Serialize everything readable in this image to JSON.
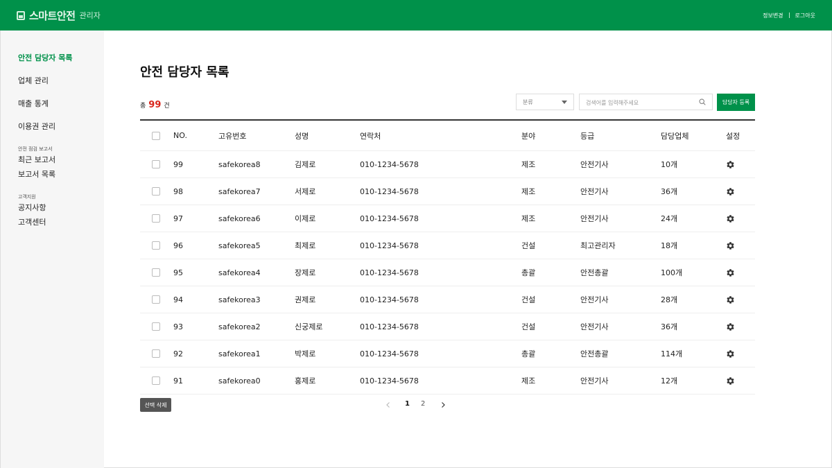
{
  "header": {
    "logo_main": "스마트안전",
    "logo_sub": "관리자",
    "links": [
      "정보변경",
      "로그아웃"
    ]
  },
  "sidebar": {
    "items": [
      "안전 담당자 목록",
      "업체 관리",
      "매출 통계",
      "이용권 관리"
    ],
    "group1_title": "안전 점검 보고서",
    "group1_items": [
      "최근 보고서",
      "보고서 목록"
    ],
    "group2_title": "고객지원",
    "group2_items": [
      "공지사항",
      "고객센터"
    ]
  },
  "main": {
    "title": "안전 담당자 목록",
    "total_prefix": "총",
    "total_count": "99",
    "total_suffix": "건",
    "category_label": "분류",
    "search_placeholder": "검색어를 입력해주세요",
    "register_label": "담당자 등록",
    "delete_label": "선택 삭제",
    "pages": [
      "1",
      "2"
    ],
    "current_page": "1"
  },
  "table": {
    "columns": [
      "NO.",
      "고유번호",
      "성명",
      "연락처",
      "분야",
      "등급",
      "담당업체",
      "설정"
    ],
    "rows": [
      {
        "no": "99",
        "id": "safekorea8",
        "name": "김제로",
        "tel": "010-1234-5678",
        "field": "제조",
        "grade": "안전기사",
        "count": "10개"
      },
      {
        "no": "98",
        "id": "safekorea7",
        "name": "서제로",
        "tel": "010-1234-5678",
        "field": "제조",
        "grade": "안전기사",
        "count": "36개"
      },
      {
        "no": "97",
        "id": "safekorea6",
        "name": "이제로",
        "tel": "010-1234-5678",
        "field": "제조",
        "grade": "안전기사",
        "count": "24개"
      },
      {
        "no": "96",
        "id": "safekorea5",
        "name": "최제로",
        "tel": "010-1234-5678",
        "field": "건설",
        "grade": "최고관리자",
        "count": "18개"
      },
      {
        "no": "95",
        "id": "safekorea4",
        "name": "장제로",
        "tel": "010-1234-5678",
        "field": "총괄",
        "grade": "안전총괄",
        "count": "100개"
      },
      {
        "no": "94",
        "id": "safekorea3",
        "name": "권제로",
        "tel": "010-1234-5678",
        "field": "건설",
        "grade": "안전기사",
        "count": "28개"
      },
      {
        "no": "93",
        "id": "safekorea2",
        "name": "신궁제로",
        "tel": "010-1234-5678",
        "field": "건설",
        "grade": "안전기사",
        "count": "36개"
      },
      {
        "no": "92",
        "id": "safekorea1",
        "name": "박제로",
        "tel": "010-1234-5678",
        "field": "총괄",
        "grade": "안전총괄",
        "count": "114개"
      },
      {
        "no": "91",
        "id": "safekorea0",
        "name": "홍제로",
        "tel": "010-1234-5678",
        "field": "제조",
        "grade": "안전기사",
        "count": "12개"
      }
    ]
  },
  "colors": {
    "brand": "#00914a",
    "count_red": "#d9261c"
  }
}
